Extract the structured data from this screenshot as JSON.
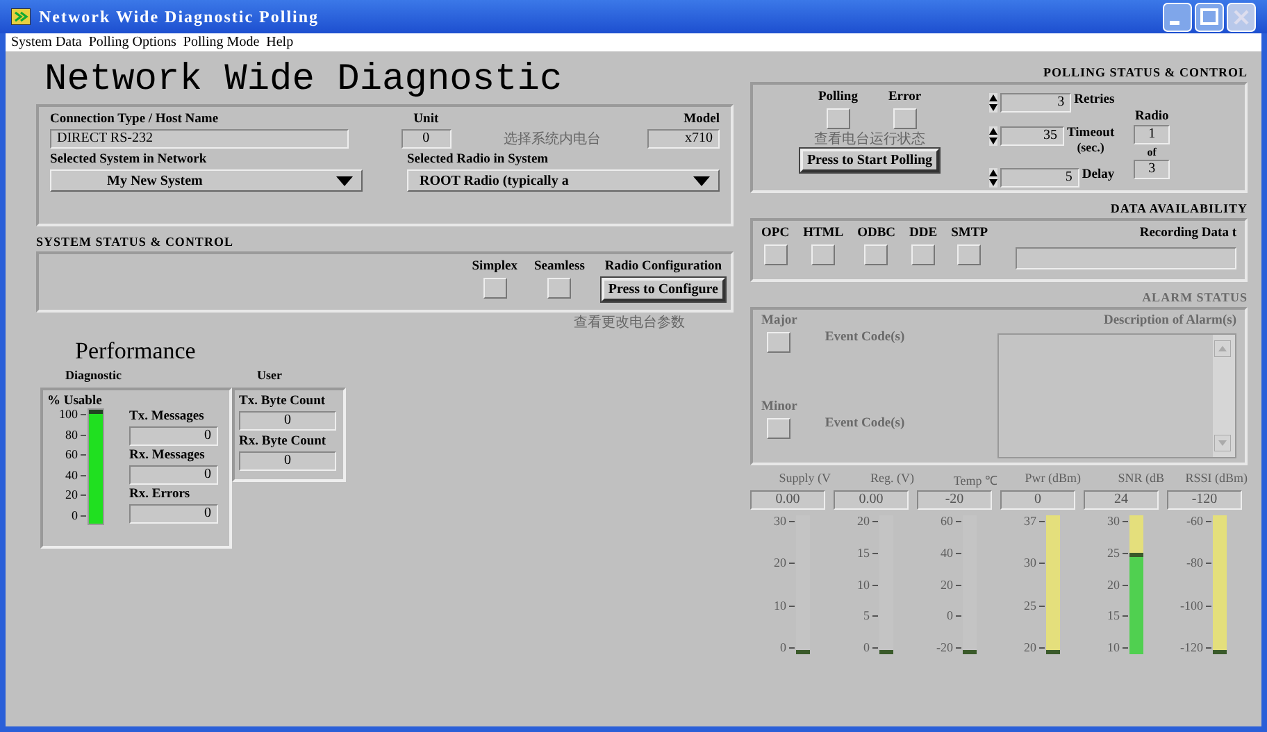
{
  "window": {
    "title": "Network Wide Diagnostic Polling"
  },
  "menu": [
    {
      "label": "System Data"
    },
    {
      "label": "Polling Options"
    },
    {
      "label": "Polling Mode"
    },
    {
      "label": "Help"
    }
  ],
  "heading": "Network Wide Diagnostic",
  "connection": {
    "fields": [
      {
        "label": "Connection Type / Host Name",
        "value": "DIRECT RS-232"
      },
      {
        "label": "Unit",
        "value": "0"
      },
      {
        "label": "Model",
        "value": "x710"
      }
    ],
    "selectors": [
      {
        "label": "Selected System in Network",
        "value": "My New System"
      },
      {
        "label": "Selected Radio in System",
        "value": "ROOT Radio (typically a"
      }
    ],
    "note": "选择系统内电台"
  },
  "system_status": {
    "title": "SYSTEM STATUS & CONTROL",
    "indicators": [
      {
        "label": "Simplex",
        "on": false
      },
      {
        "label": "Seamless",
        "on": false
      }
    ],
    "config_label": "Radio Configuration",
    "config_button": "Press to Configure",
    "note": "查看更改电台参数"
  },
  "performance": {
    "title": "Performance",
    "diagnostic": {
      "title": "Diagnostic",
      "gauge": {
        "label": "% Usable",
        "ticks": [
          "100",
          "80",
          "60",
          "40",
          "20",
          "0"
        ],
        "level": 1
      },
      "counters": [
        {
          "label": "Tx. Messages",
          "value": "0"
        },
        {
          "label": "Rx. Messages",
          "value": "0"
        },
        {
          "label": "Rx. Errors",
          "value": "0"
        }
      ]
    },
    "user": {
      "title": "User",
      "counters": [
        {
          "label": "Tx. Byte Count",
          "value": "0"
        },
        {
          "label": "Rx. Byte Count",
          "value": "0"
        }
      ]
    }
  },
  "polling": {
    "title": "POLLING STATUS & CONTROL",
    "indicators": [
      {
        "label": "Polling",
        "on": false
      },
      {
        "label": "Error",
        "on": false
      }
    ],
    "note": "查看电台运行状态",
    "button": "Press to Start Polling",
    "spinners": [
      {
        "value": "3",
        "label": "Retries"
      },
      {
        "value": "35",
        "label": "Timeout",
        "sublabel": "(sec.)"
      },
      {
        "value": "5",
        "label": "Delay"
      }
    ],
    "radio": {
      "label": "Radio",
      "current": "1",
      "of": "of",
      "total": "3"
    }
  },
  "data_availability": {
    "title": "DATA AVAILABILITY",
    "indicators": [
      {
        "label": "OPC",
        "on": false
      },
      {
        "label": "HTML",
        "on": false
      },
      {
        "label": "ODBC",
        "on": false
      },
      {
        "label": "DDE",
        "on": false
      },
      {
        "label": "SMTP",
        "on": false
      }
    ],
    "recording_label": "Recording Data t"
  },
  "alarm_status": {
    "title": "ALARM STATUS",
    "disabled": true,
    "major": {
      "label": "Major",
      "on": false,
      "event_label": "Event Code(s)"
    },
    "minor": {
      "label": "Minor",
      "on": false,
      "event_label": "Event Code(s)"
    },
    "description_label": "Description of Alarm(s)"
  },
  "meters": [
    {
      "label": "Supply (V",
      "reading": "0.00",
      "ticks": [
        "30",
        "20",
        "10",
        "0"
      ],
      "level": 0,
      "color": "#c4c4c4"
    },
    {
      "label": "Reg. (V)",
      "reading": "0.00",
      "ticks": [
        "20",
        "15",
        "10",
        "5",
        "0"
      ],
      "level": 0,
      "color": "#c4c4c4"
    },
    {
      "label": "Temp ℃",
      "reading": "-20",
      "ticks": [
        "60",
        "40",
        "20",
        "0",
        "-20"
      ],
      "level": 0,
      "color": "#c4c4c4"
    },
    {
      "label": "Pwr (dBm)",
      "reading": "0",
      "ticks": [
        "37",
        "30",
        "25",
        "20"
      ],
      "level": 0,
      "color": "#e4df7c"
    },
    {
      "label": "SNR (dB",
      "reading": "24",
      "ticks": [
        "30",
        "25",
        "20",
        "15",
        "10"
      ],
      "level": 0.7,
      "color": "#e4df7c"
    },
    {
      "label": "RSSI (dBm)",
      "reading": "-120",
      "ticks": [
        "-60",
        "-80",
        "-100",
        "-120"
      ],
      "level": 0,
      "color": "#e4df7c"
    }
  ]
}
